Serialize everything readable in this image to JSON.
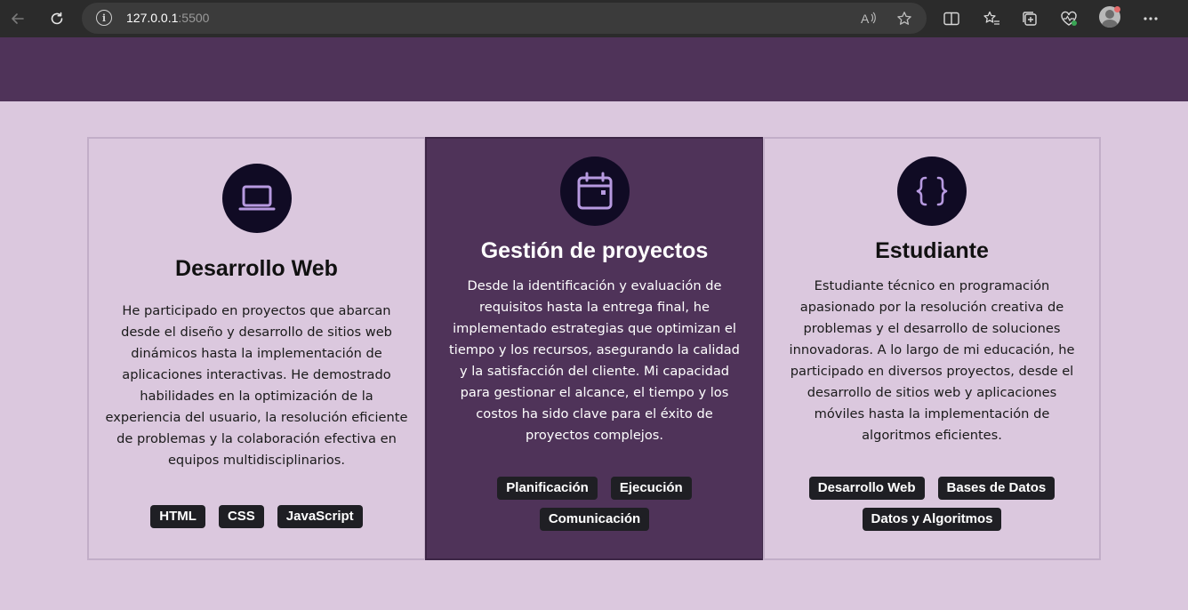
{
  "browser": {
    "url_host": "127.0.0.1",
    "url_port": ":5500"
  },
  "cards": [
    {
      "title": "Desarrollo Web",
      "icon": "laptop-icon",
      "text": "He participado en proyectos que abarcan desde el diseño y desarrollo de sitios web dinámicos hasta la implementación de aplicaciones interactivas. He demostrado habilidades en la optimización de la experiencia del usuario, la resolución eficiente de problemas y la colaboración efectiva en equipos multidisciplinarios.",
      "tags": [
        "HTML",
        "CSS",
        "JavaScript"
      ]
    },
    {
      "title": "Gestión de proyectos",
      "icon": "calendar-icon",
      "text": "Desde la identificación y evaluación de requisitos hasta la entrega final, he implementado estrategias que optimizan el tiempo y los recursos, asegurando la calidad y la satisfacción del cliente. Mi capacidad para gestionar el alcance, el tiempo y los costos ha sido clave para el éxito de proyectos complejos.",
      "tags": [
        "Planificación",
        "Ejecución",
        "Comunicación"
      ]
    },
    {
      "title": "Estudiante",
      "icon": "code-braces-icon",
      "text": "Estudiante técnico en programación apasionado por la resolución creativa de problemas y el desarrollo de soluciones innovadoras. A lo largo de mi educación, he participado en diversos proyectos, desde el desarrollo de sitios web y aplicaciones móviles hasta la implementación de algoritmos eficientes.",
      "tags": [
        "Desarrollo Web",
        "Bases de Datos",
        "Datos y Algoritmos"
      ]
    }
  ],
  "colors": {
    "page_bg": "#dbc8de",
    "accent_purple": "#4f3359",
    "icon_circle": "#100b24",
    "icon_glyph": "#b79ae0",
    "tag_bg": "#1f1f24"
  }
}
